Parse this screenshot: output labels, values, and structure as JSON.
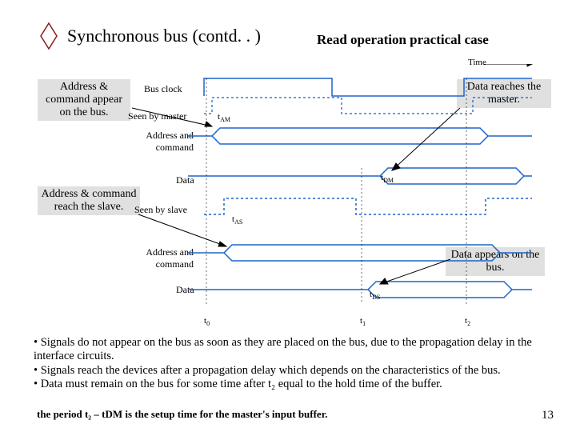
{
  "title": "Synchronous bus (contd. .  )",
  "subtitle": "Read operation practical case",
  "timeLabel": "Time",
  "callouts": {
    "addrCmdAppear": "Address & command appear on the bus.",
    "dataReaches": "Data reaches the master.",
    "addrCmdReach": "Address & command reach the slave.",
    "dataAppears": "Data appears on the bus."
  },
  "signals": {
    "busClock": "Bus clock",
    "seenByMaster": "Seen by master",
    "addrCmd1": "Address and command",
    "data1": "Data",
    "seenBySlave": "Seen by slave",
    "addrCmd2": "Address and command",
    "data2": "Data"
  },
  "timing": {
    "tAM": "AM",
    "tDM": "DM",
    "tAS": "AS",
    "tDS": "DS",
    "t0": "0",
    "t1": "1",
    "t2": "2"
  },
  "bullets": {
    "b1": "• Signals do not appear on the bus as soon as they are placed on the bus, due to the propagation delay in the interface circuits.",
    "b2": "• Signals reach the devices after a propagation delay which depends on the characteristics of the bus.",
    "b3": "• Data must remain on the bus for some time after t₂ equal to the hold time of the buffer."
  },
  "imgtext": "the period t₂ – tDM is the setup time for the master's input buffer.",
  "pageNum": "13"
}
